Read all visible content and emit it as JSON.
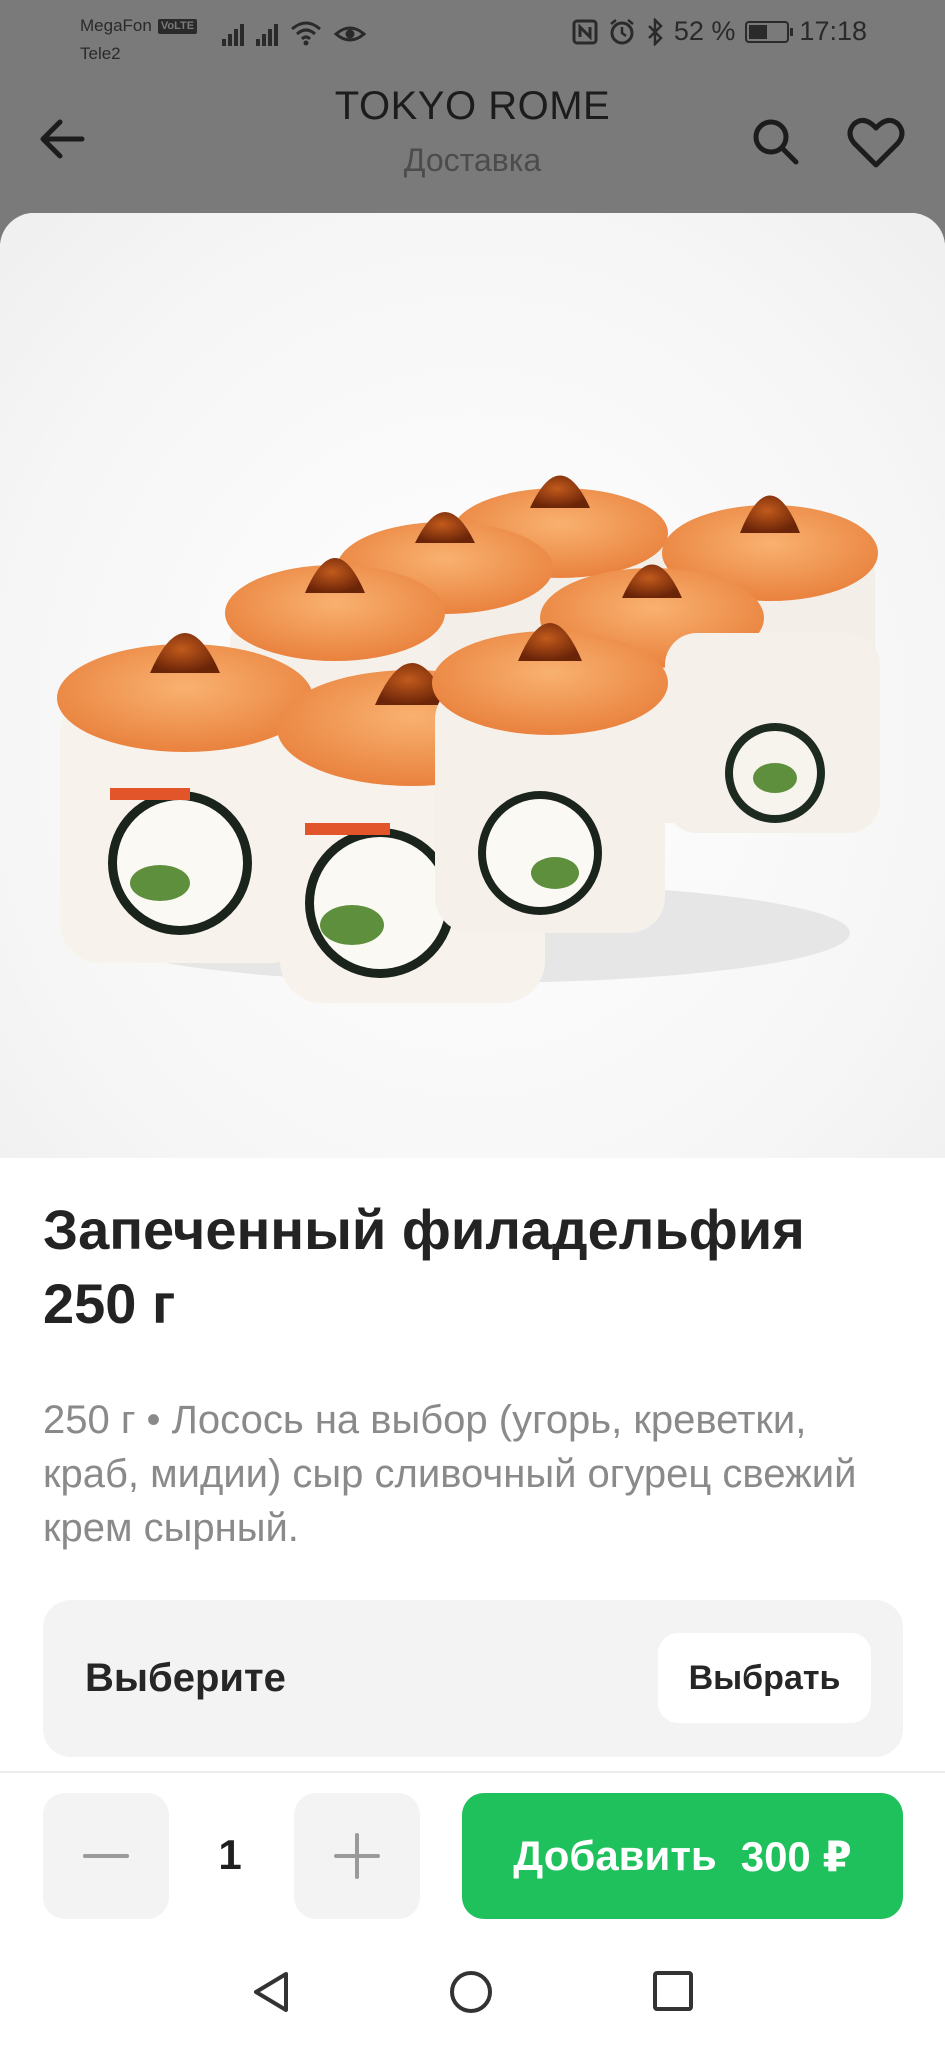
{
  "status_bar": {
    "carrier1": "MegaFon",
    "carrier1_badge": "VoLTE",
    "carrier2": "Tele2",
    "battery_text": "52 %",
    "battery_level": 0.52,
    "time": "17:18",
    "icons": [
      "signal-icon",
      "signal-icon",
      "wifi-icon",
      "eye-icon",
      "nfc-icon",
      "alarm-icon",
      "bluetooth-icon",
      "battery-icon"
    ]
  },
  "header": {
    "title": "TOKYO ROME",
    "subtitle": "Доставка",
    "icons": [
      "back-arrow-icon",
      "search-icon",
      "heart-icon"
    ]
  },
  "product": {
    "title": "Запеченный филадельфия 250 г",
    "description": "250 г • Лосось на выбор (угорь, креветки, краб, мидии) сыр сливочный огурец свежий крем сырный."
  },
  "option": {
    "label": "Выберите",
    "button_label": "Выбрать"
  },
  "cart": {
    "quantity": "1",
    "add_label": "Добавить",
    "price": "300 ₽",
    "accent_color": "#1ec15b"
  },
  "nav_bar": {
    "icons": [
      "nav-back-icon",
      "nav-home-icon",
      "nav-recents-icon"
    ]
  }
}
